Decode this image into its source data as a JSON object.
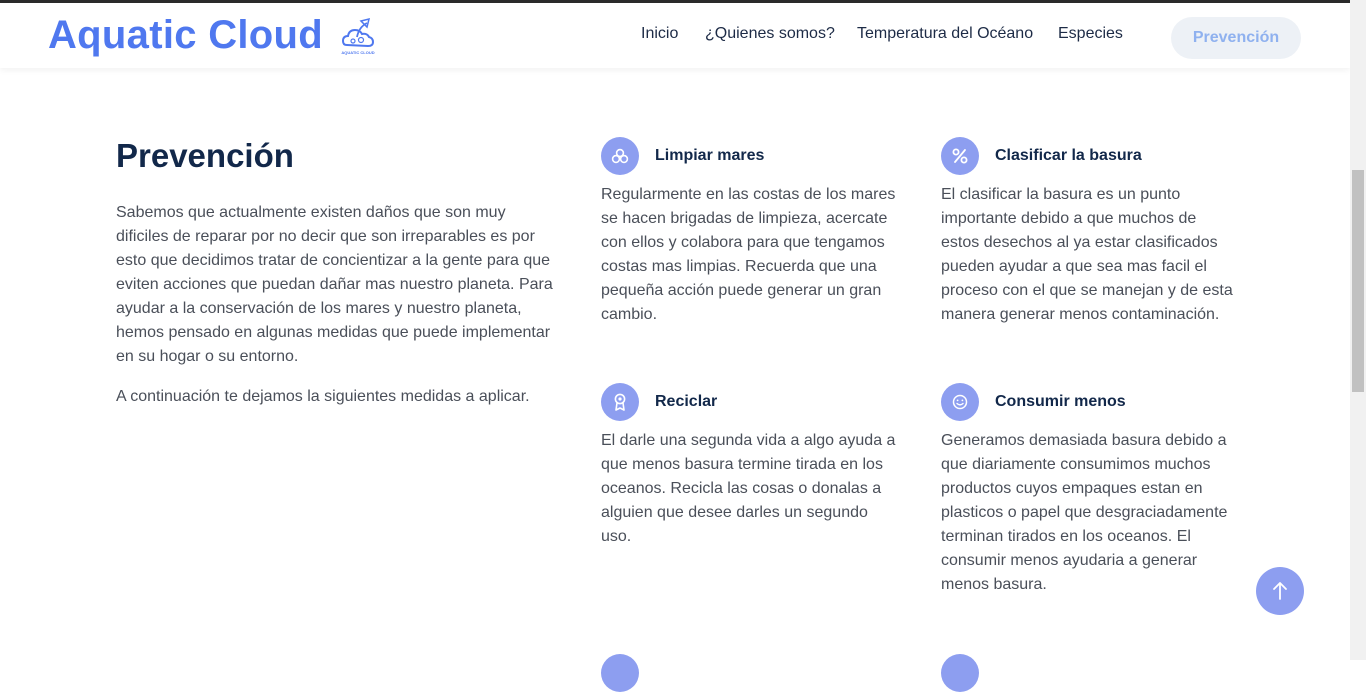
{
  "header": {
    "brand": "Aquatic Cloud",
    "logo_caption": "AQUATIC CLOUD",
    "nav": [
      {
        "label": "Inicio"
      },
      {
        "label": "¿Quienes somos?"
      },
      {
        "label": "Temperatura del Océano"
      },
      {
        "label": "Especies"
      }
    ],
    "cta": "Prevención"
  },
  "intro": {
    "title": "Prevención",
    "paragraph1": "Sabemos que actualmente existen daños que son muy dificiles de reparar por no decir que son irreparables es por esto que decidimos tratar de concientizar a la gente para que eviten acciones que puedan dañar mas nuestro planeta. Para ayudar a la conservación de los mares y nuestro planeta, hemos pensado en algunas medidas que puede implementar en su hogar o su entorno.",
    "paragraph2": "A continuación te dejamos la siguientes medidas a aplicar."
  },
  "cards": [
    {
      "icon": "circles-icon",
      "title": "Limpiar mares",
      "text": "Regularmente en las costas de los mares se hacen brigadas de limpieza, acercate con ellos y colabora para que tengamos costas mas limpias. Recuerda que una pequeña acción puede generar un gran cambio."
    },
    {
      "icon": "percent-icon",
      "title": "Clasificar la basura",
      "text": "El clasificar la basura es un punto importante debido a que muchos de estos desechos al ya estar clasificados pueden ayudar a que sea mas facil el proceso con el que se manejan y de esta manera generar menos contaminación."
    },
    {
      "icon": "award-icon",
      "title": "Reciclar",
      "text": "El darle una segunda vida a algo ayuda a que menos basura termine tirada en los oceanos. Recicla las cosas o donalas a alguien que desee darles un segundo uso."
    },
    {
      "icon": "smile-icon",
      "title": "Consumir menos",
      "text": "Generamos demasiada basura debido a que diariamente consumimos muchos productos cuyos empaques estan en plasticos o papel que desgraciadamente terminan tirados en los oceanos. El consumir menos ayudaria a generar menos basura."
    }
  ],
  "colors": {
    "brand": "#4f78ef",
    "accent": "#8d9ef0",
    "heading": "#12284a",
    "body_text": "#4a4f59"
  }
}
